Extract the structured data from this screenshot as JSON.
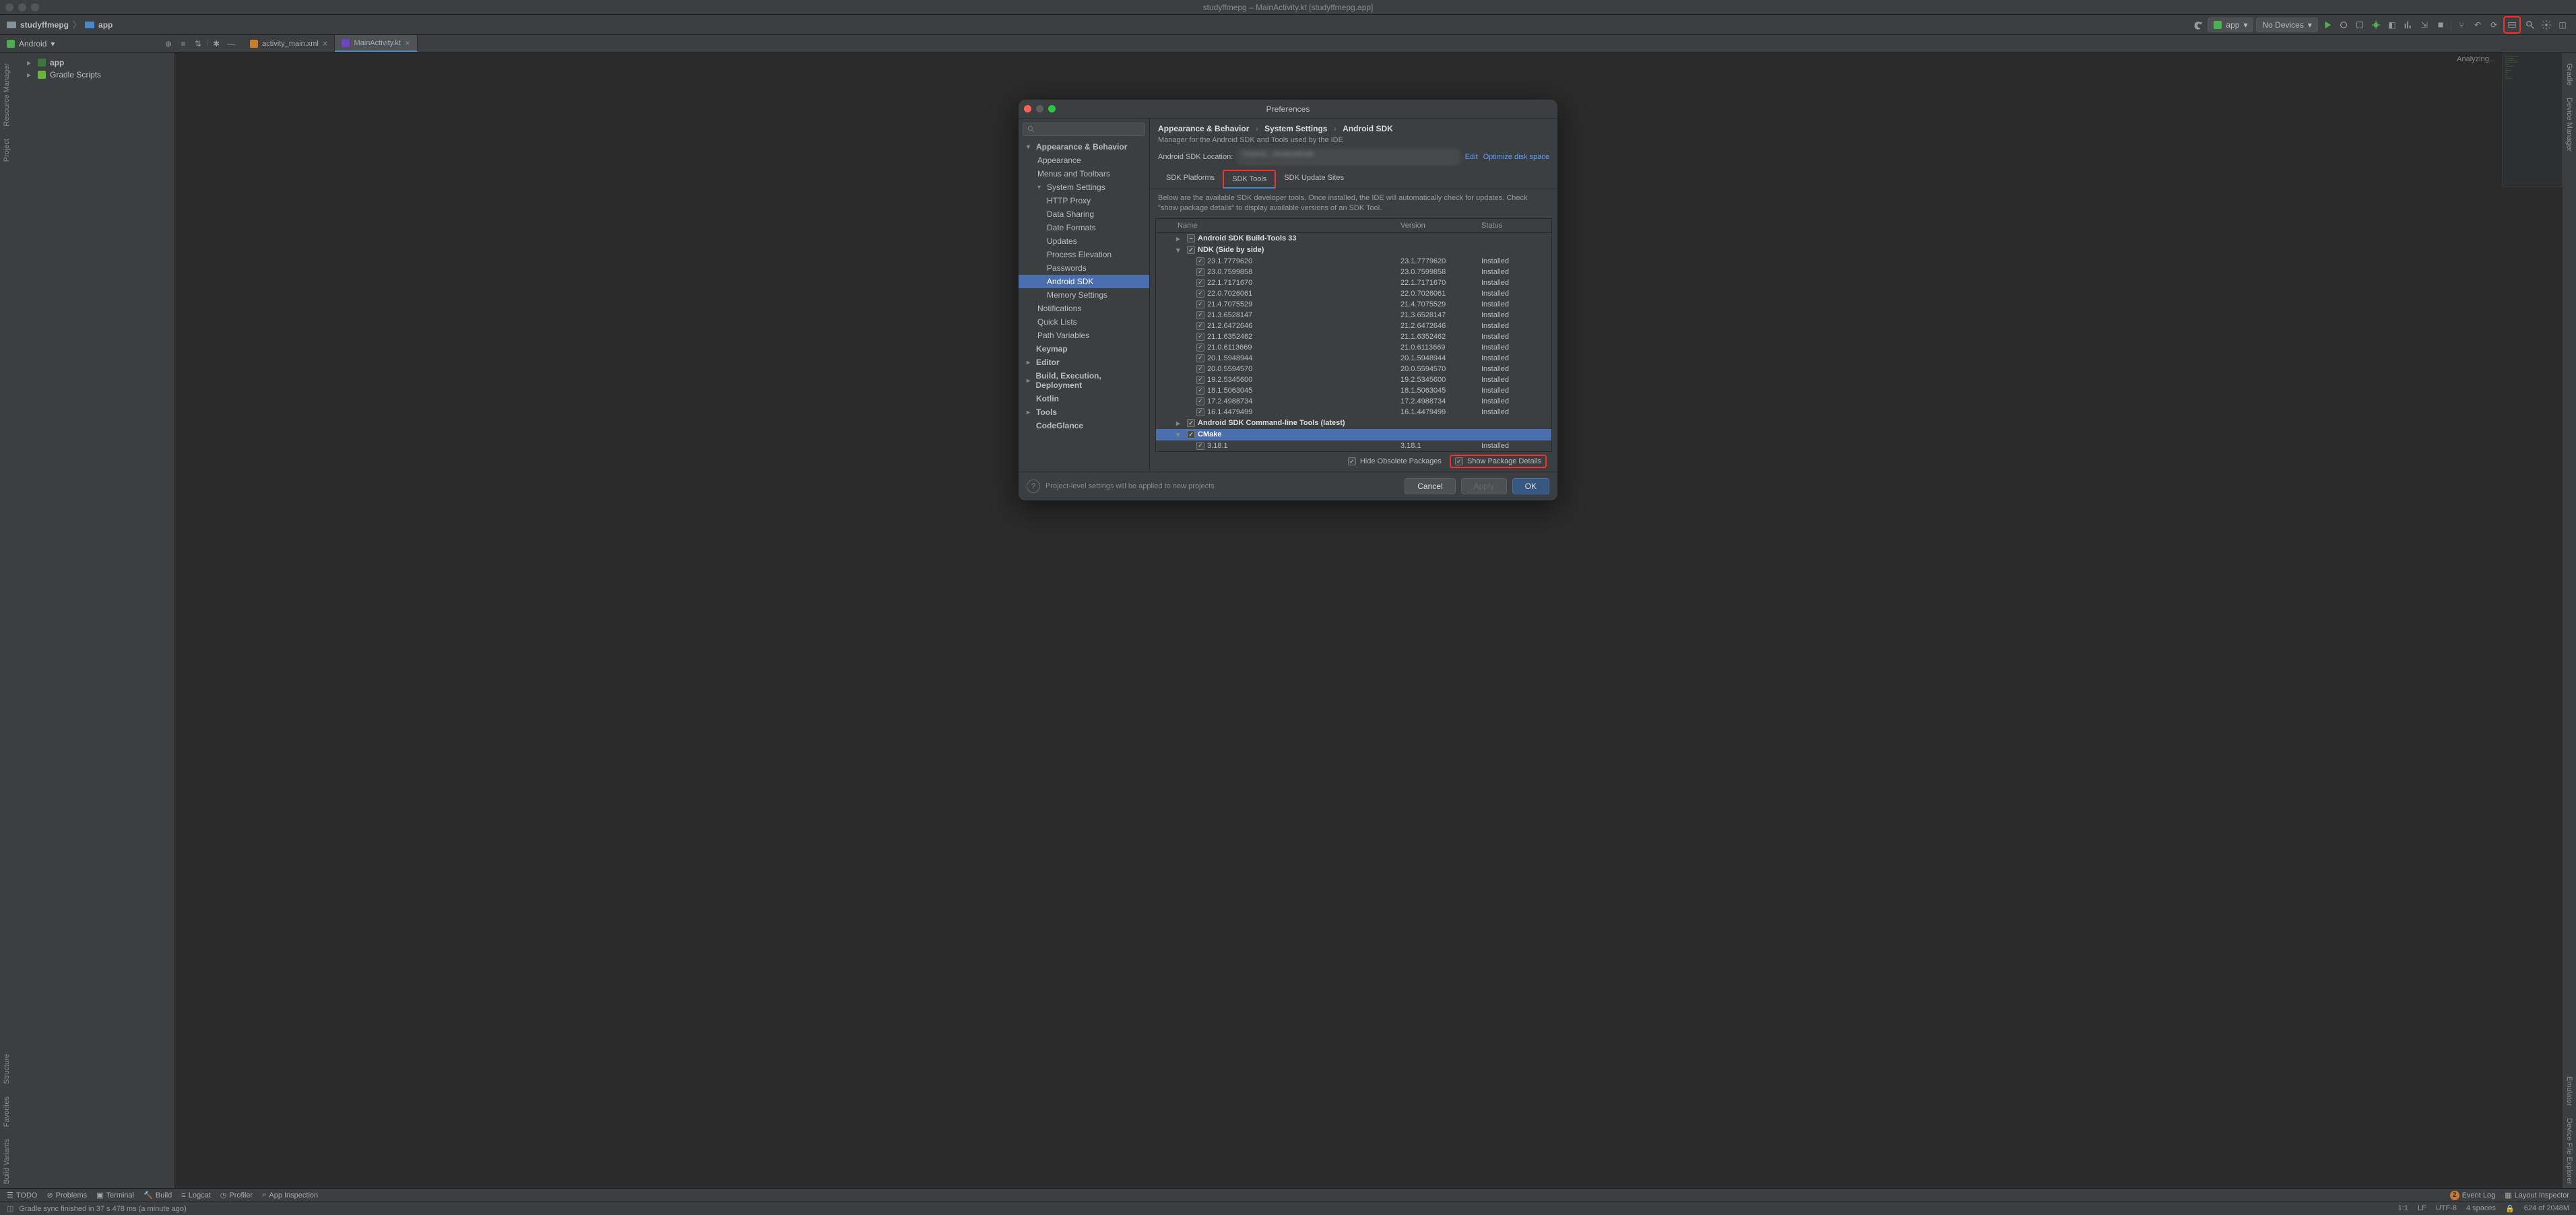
{
  "window": {
    "title": "studyffmepg – MainActivity.kt [studyffmepg.app]"
  },
  "breadcrumb": {
    "project": "studyffmepg",
    "module": "app"
  },
  "runbar": {
    "config": "app",
    "device": "No Devices",
    "chevdown": "▾"
  },
  "proj_dropdown": {
    "label": "Android",
    "chev": "▾"
  },
  "tree": {
    "app": "app",
    "gradle": "Gradle Scripts"
  },
  "tabs": {
    "xml": "activity_main.xml",
    "kt": "MainActivity.kt"
  },
  "editor": {
    "analyzing": "Analyzing..."
  },
  "left_tools": {
    "resource": "Resource Manager",
    "project": "Project",
    "structure": "Structure",
    "favorites": "Favorites",
    "bvariants": "Build Variants"
  },
  "right_tools": {
    "gradle": "Gradle",
    "devman": "Device Manager",
    "emulator": "Emulator",
    "devexp": "Device File Explorer"
  },
  "dialog": {
    "title": "Preferences",
    "breadcrumb": {
      "a": "Appearance & Behavior",
      "b": "System Settings",
      "c": "Android SDK"
    },
    "desc": "Manager for the Android SDK and Tools used by the IDE",
    "sdkloc_label": "Android SDK Location:",
    "edit": "Edit",
    "optimize": "Optimize disk space",
    "tabs": {
      "platforms": "SDK Platforms",
      "tools": "SDK Tools",
      "updates": "SDK Update Sites"
    },
    "tab_desc": "Below are the available SDK developer tools. Once installed, the IDE will automatically check for updates. Check \"show package details\" to display available versions of an SDK Tool.",
    "cols": {
      "name": "Name",
      "version": "Version",
      "status": "Status"
    },
    "hide_obs": "Hide Obsolete Packages",
    "show_det": "Show Package Details",
    "footer_text": "Project-level settings will be applied to new projects",
    "buttons": {
      "cancel": "Cancel",
      "apply": "Apply",
      "ok": "OK"
    }
  },
  "settings_tree": [
    {
      "label": "Appearance & Behavior",
      "bold": true,
      "chev": "▾"
    },
    {
      "label": "Appearance",
      "l": 2
    },
    {
      "label": "Menus and Toolbars",
      "l": 2
    },
    {
      "label": "System Settings",
      "l": 2,
      "bold": false,
      "chev": "▾"
    },
    {
      "label": "HTTP Proxy",
      "l": 3
    },
    {
      "label": "Data Sharing",
      "l": 3
    },
    {
      "label": "Date Formats",
      "l": 3
    },
    {
      "label": "Updates",
      "l": 3
    },
    {
      "label": "Process Elevation",
      "l": 3
    },
    {
      "label": "Passwords",
      "l": 3
    },
    {
      "label": "Android SDK",
      "l": 3,
      "selected": true
    },
    {
      "label": "Memory Settings",
      "l": 3
    },
    {
      "label": "Notifications",
      "l": 2
    },
    {
      "label": "Quick Lists",
      "l": 2
    },
    {
      "label": "Path Variables",
      "l": 2
    },
    {
      "label": "Keymap",
      "bold": true
    },
    {
      "label": "Editor",
      "bold": true,
      "chev": "▸"
    },
    {
      "label": "Build, Execution, Deployment",
      "bold": true,
      "chev": "▸"
    },
    {
      "label": "Kotlin",
      "bold": true
    },
    {
      "label": "Tools",
      "bold": true,
      "chev": "▸"
    },
    {
      "label": "CodeGlance",
      "bold": true
    }
  ],
  "packages": [
    {
      "type": "group",
      "name": "Android SDK Build-Tools 33",
      "chev": "▸",
      "cb": "minus"
    },
    {
      "type": "group",
      "name": "NDK (Side by side)",
      "chev": "▾",
      "cb": "checked"
    },
    {
      "type": "item",
      "name": "23.1.7779620",
      "ver": "23.1.7779620",
      "stat": "Installed",
      "cb": "checked"
    },
    {
      "type": "item",
      "name": "23.0.7599858",
      "ver": "23.0.7599858",
      "stat": "Installed",
      "cb": "checked"
    },
    {
      "type": "item",
      "name": "22.1.7171670",
      "ver": "22.1.7171670",
      "stat": "Installed",
      "cb": "checked"
    },
    {
      "type": "item",
      "name": "22.0.7026061",
      "ver": "22.0.7026061",
      "stat": "Installed",
      "cb": "checked"
    },
    {
      "type": "item",
      "name": "21.4.7075529",
      "ver": "21.4.7075529",
      "stat": "Installed",
      "cb": "checked"
    },
    {
      "type": "item",
      "name": "21.3.6528147",
      "ver": "21.3.6528147",
      "stat": "Installed",
      "cb": "checked"
    },
    {
      "type": "item",
      "name": "21.2.6472646",
      "ver": "21.2.6472646",
      "stat": "Installed",
      "cb": "checked"
    },
    {
      "type": "item",
      "name": "21.1.6352462",
      "ver": "21.1.6352462",
      "stat": "Installed",
      "cb": "checked"
    },
    {
      "type": "item",
      "name": "21.0.6113669",
      "ver": "21.0.6113669",
      "stat": "Installed",
      "cb": "checked"
    },
    {
      "type": "item",
      "name": "20.1.5948944",
      "ver": "20.1.5948944",
      "stat": "Installed",
      "cb": "checked"
    },
    {
      "type": "item",
      "name": "20.0.5594570",
      "ver": "20.0.5594570",
      "stat": "Installed",
      "cb": "checked"
    },
    {
      "type": "item",
      "name": "19.2.5345600",
      "ver": "19.2.5345600",
      "stat": "Installed",
      "cb": "checked"
    },
    {
      "type": "item",
      "name": "18.1.5063045",
      "ver": "18.1.5063045",
      "stat": "Installed",
      "cb": "checked"
    },
    {
      "type": "item",
      "name": "17.2.4988734",
      "ver": "17.2.4988734",
      "stat": "Installed",
      "cb": "checked"
    },
    {
      "type": "item",
      "name": "16.1.4479499",
      "ver": "16.1.4479499",
      "stat": "Installed",
      "cb": "checked"
    },
    {
      "type": "group",
      "name": "Android SDK Command-line Tools (latest)",
      "chev": "▸",
      "cb": "checked"
    },
    {
      "type": "group",
      "name": "CMake",
      "chev": "▾",
      "cb": "checked",
      "selected": true
    },
    {
      "type": "item",
      "name": "3.18.1",
      "ver": "3.18.1",
      "stat": "Installed",
      "cb": "checked"
    }
  ],
  "bottom_tools": {
    "todo": "TODO",
    "problems": "Problems",
    "terminal": "Terminal",
    "build": "Build",
    "logcat": "Logcat",
    "profiler": "Profiler",
    "appinsp": "App Inspection",
    "eventlog": "Event Log",
    "eventlog_count": "2",
    "layoutinsp": "Layout Inspector"
  },
  "status": {
    "msg": "Gradle sync finished in 37 s 478 ms (a minute ago)",
    "pos": "1:1",
    "lf": "LF",
    "enc": "UTF-8",
    "spaces": "4 spaces",
    "mem": "624 of 2048M"
  }
}
